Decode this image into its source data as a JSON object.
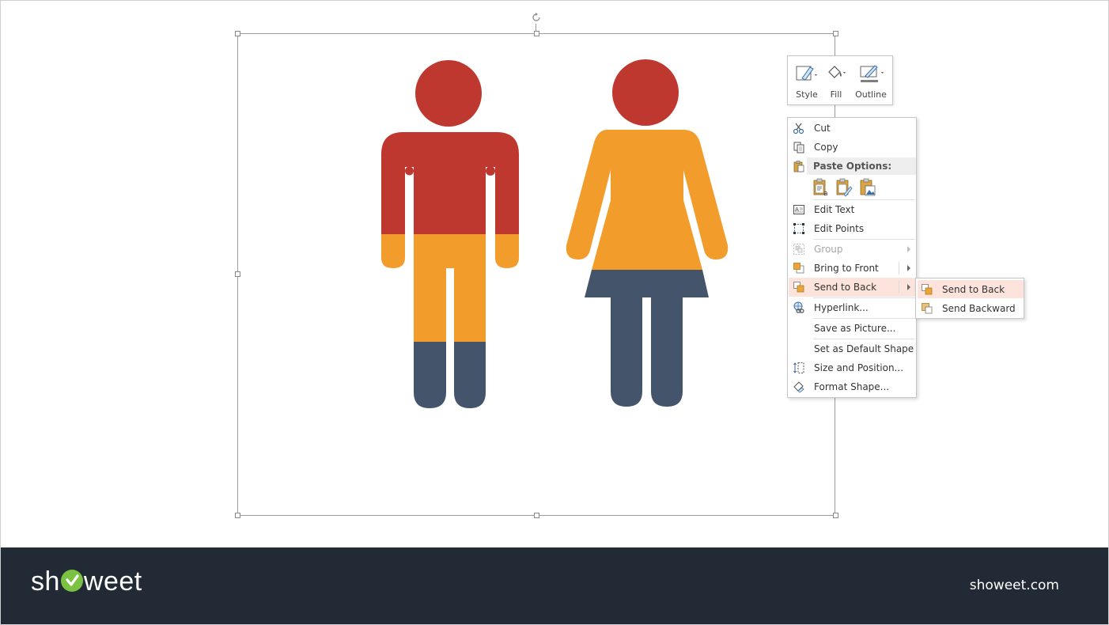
{
  "mini_toolbar": {
    "style_label": "Style",
    "fill_label": "Fill",
    "outline_label": "Outline"
  },
  "context_menu": {
    "cut": "Cut",
    "copy": "Copy",
    "paste_options": "Paste Options:",
    "edit_text": "Edit Text",
    "edit_points": "Edit Points",
    "group": "Group",
    "bring_to_front": "Bring to Front",
    "send_to_back": "Send to Back",
    "hyperlink": "Hyperlink...",
    "save_as_picture": "Save as Picture...",
    "set_default_shape": "Set as Default Shape",
    "size_and_position": "Size and Position...",
    "format_shape": "Format Shape..."
  },
  "submenu": {
    "send_to_back": "Send to Back",
    "send_backward": "Send Backward"
  },
  "footer": {
    "logo_text_left": "sh",
    "logo_text_right": "weet",
    "site": "showeet.com"
  },
  "colors": {
    "red": "#bf3830",
    "orange": "#f29d2b",
    "slate": "#44546a",
    "footer_bg": "#222a35",
    "logo_green": "#7cc242",
    "menu_hover": "#fce4dc"
  }
}
